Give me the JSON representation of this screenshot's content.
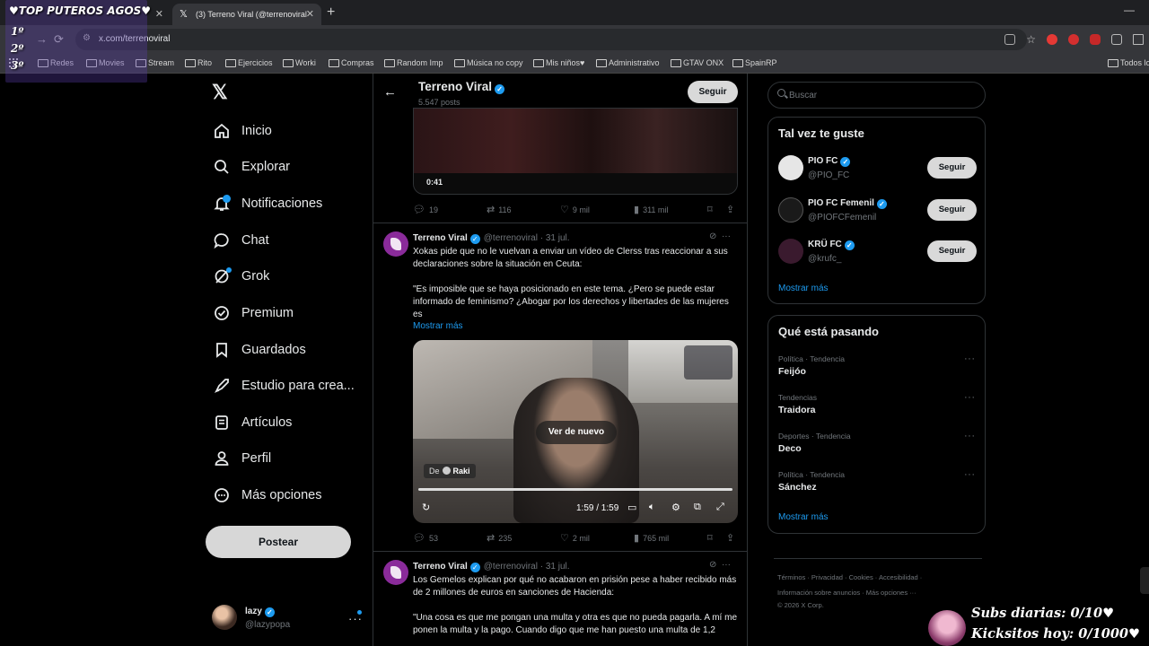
{
  "browser": {
    "tabs": [
      {
        "label": "",
        "active": false
      },
      {
        "label": "(3) Terreno Viral (@terrenoviral",
        "active": true
      }
    ],
    "url": "x.com/terrenoviral",
    "bookmarks": [
      "Redes",
      "Movies",
      "Stream",
      "Rito",
      "Ejercicios",
      "Worki",
      "Compras",
      "Random Imp",
      "Música no copy",
      "Mis niños♥",
      "Administrativo",
      "GTAV ONX",
      "SpainRP",
      "Todos los"
    ]
  },
  "overlay": {
    "title": "♥TOP PUTEROS AGOS♥",
    "ranks": [
      "1º",
      "2º",
      "3º"
    ],
    "subs_daily": "Subs diarias: 0/10♥",
    "kicksitos": "Kicksitos hoy: 0/1000♥"
  },
  "sidebar": {
    "items": [
      {
        "label": "Inicio",
        "icon": "home-icon"
      },
      {
        "label": "Explorar",
        "icon": "search-icon"
      },
      {
        "label": "Notificaciones",
        "icon": "bell-icon"
      },
      {
        "label": "Chat",
        "icon": "chat-icon"
      },
      {
        "label": "Grok",
        "icon": "grok-icon"
      },
      {
        "label": "Premium",
        "icon": "premium-icon"
      },
      {
        "label": "Guardados",
        "icon": "bookmark-icon"
      },
      {
        "label": "Estudio para crea...",
        "icon": "rocket-icon"
      },
      {
        "label": "Artículos",
        "icon": "article-icon"
      },
      {
        "label": "Perfil",
        "icon": "person-icon"
      },
      {
        "label": "Más opciones",
        "icon": "more-icon"
      }
    ],
    "post_label": "Postear",
    "me": {
      "name": "lazy",
      "handle": "@lazypopa"
    }
  },
  "profile": {
    "name": "Terreno Viral",
    "posts": "5.547 posts",
    "follow_label": "Seguir"
  },
  "tweets": [
    {
      "media_duration": "0:41",
      "replies": "19",
      "reposts": "116",
      "likes": "9 mil",
      "views": "311 mil"
    },
    {
      "name": "Terreno Viral",
      "handle": "@terrenoviral · 31 jul.",
      "text1": "Xokas pide que no le vuelvan a enviar un vídeo de Clerss tras reaccionar a sus declaraciones sobre la situación en Ceuta:",
      "text2": "\"Es imposible que se haya posicionado en este tema. ¿Pero se puede estar informado de feminismo? ¿Abogar por los derechos y libertades de las mujeres es",
      "show_more": "Mostrar más",
      "video": {
        "replay_label": "Ver de nuevo",
        "source_prefix": "De",
        "source": "Raki",
        "time": "1:59 / 1:59",
        "progress": 1.0
      },
      "replies": "53",
      "reposts": "235",
      "likes": "2 mil",
      "views": "765 mil"
    },
    {
      "name": "Terreno Viral",
      "handle": "@terrenoviral · 31 jul.",
      "text1": "Los Gemelos explican por qué no acabaron en prisión pese a haber recibido más de 2 millones de euros en sanciones de Hacienda:",
      "text2": "\"Una cosa es que me pongan una multa y otra es que no pueda pagarla. A mí me ponen la multa y la pago. Cuando digo que me han puesto una multa de 1,2"
    }
  ],
  "right": {
    "search_placeholder": "Buscar",
    "suggest_title": "Tal vez te guste",
    "suggestions": [
      {
        "name": "PIO FC",
        "handle": "@PIO_FC",
        "button": "Seguir"
      },
      {
        "name": "PIO FC Femenil",
        "handle": "@PIOFCFemenil",
        "button": "Seguir"
      },
      {
        "name": "KRÜ FC",
        "handle": "@krufc_",
        "button": "Seguir"
      }
    ],
    "suggest_more": "Mostrar más",
    "trends_title": "Qué está pasando",
    "trends": [
      {
        "category": "Política · Tendencia",
        "name": "Feijóo"
      },
      {
        "category": "Tendencias",
        "name": "Traidora"
      },
      {
        "category": "Deportes · Tendencia",
        "name": "Deco"
      },
      {
        "category": "Política · Tendencia",
        "name": "Sánchez"
      }
    ],
    "trends_more": "Mostrar más",
    "footer1": "Términos  ·  Privacidad  ·  Cookies  ·  Accesibilidad  ·",
    "footer2": "Información sobre anuncios  ·  Más opciones ···",
    "footer3": "© 2026 X Corp."
  },
  "colors": {
    "accent": "#1d9bf0",
    "background": "#000000",
    "border": "#2f3336",
    "muted": "#71767b"
  }
}
